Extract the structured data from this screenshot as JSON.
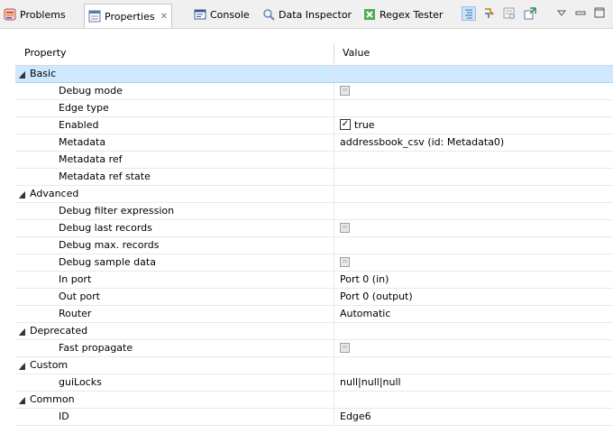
{
  "tabs": [
    {
      "label": "Problems",
      "icon": "problems-icon"
    },
    {
      "label": "Properties",
      "icon": "properties-icon",
      "active": true
    },
    {
      "label": "Console",
      "icon": "console-icon"
    },
    {
      "label": "Data Inspector",
      "icon": "magnifier-icon"
    },
    {
      "label": "Regex Tester",
      "icon": "regex-icon"
    }
  ],
  "toolbar": [
    "show-categories-icon",
    "filter-advanced-icon",
    "restore-defaults-icon",
    "pin-icon",
    "view-menu-icon",
    "minimize-icon",
    "maximize-icon"
  ],
  "table": {
    "col_property": "Property",
    "col_value": "Value"
  },
  "groups": [
    {
      "name": "Basic",
      "selected": true,
      "rows": [
        {
          "label": "Debug mode",
          "value": "",
          "checkbox": "disabled"
        },
        {
          "label": "Edge type",
          "value": ""
        },
        {
          "label": "Enabled",
          "value": "true",
          "checkbox": "checked"
        },
        {
          "label": "Metadata",
          "value": "addressbook_csv (id: Metadata0)"
        },
        {
          "label": "Metadata ref",
          "value": ""
        },
        {
          "label": "Metadata ref state",
          "value": ""
        }
      ]
    },
    {
      "name": "Advanced",
      "rows": [
        {
          "label": "Debug filter expression",
          "value": ""
        },
        {
          "label": "Debug last records",
          "value": "",
          "checkbox": "disabled"
        },
        {
          "label": "Debug max. records",
          "value": ""
        },
        {
          "label": "Debug sample data",
          "value": "",
          "checkbox": "disabled"
        },
        {
          "label": "In port",
          "value": "Port 0 (in)"
        },
        {
          "label": "Out port",
          "value": "Port 0 (output)"
        },
        {
          "label": "Router",
          "value": "Automatic"
        }
      ]
    },
    {
      "name": "Deprecated",
      "rows": [
        {
          "label": "Fast propagate",
          "value": "",
          "checkbox": "disabled"
        }
      ]
    },
    {
      "name": "Custom",
      "rows": [
        {
          "label": "guiLocks",
          "value": "null|null|null"
        }
      ]
    },
    {
      "name": "Common",
      "rows": [
        {
          "label": "ID",
          "value": "Edge6"
        }
      ]
    }
  ],
  "colors": {
    "selection": "#cde8ff",
    "tabbar": "#f0f0f0"
  }
}
